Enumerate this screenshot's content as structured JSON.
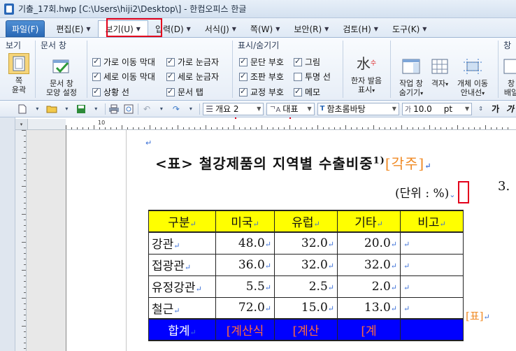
{
  "window": {
    "title": "기출_17회.hwp [C:\\Users\\hiji2\\Desktop\\] - 한컴오피스 한글"
  },
  "menu": {
    "tabs": [
      {
        "label": "파일(F)"
      },
      {
        "label": "편집(E)"
      },
      {
        "label": "보기(U)"
      },
      {
        "label": "입력(D)"
      },
      {
        "label": "서식(J)"
      },
      {
        "label": "쪽(W)"
      },
      {
        "label": "보안(R)"
      },
      {
        "label": "검토(H)"
      },
      {
        "label": "도구(K)"
      }
    ]
  },
  "ribbon": {
    "groups": {
      "view": "보기",
      "doc_window": "문서 창",
      "show_hide": "표시/숨기기",
      "window": "창"
    },
    "page_width": {
      "line1": "쪽",
      "line2": "윤곽"
    },
    "doc_window_style": {
      "line1": "문서 창",
      "line2": "모양 설정"
    },
    "checks": [
      {
        "label": "가로 이동 막대",
        "checked": true
      },
      {
        "label": "세로 이동 막대",
        "checked": true
      },
      {
        "label": "상황 선",
        "checked": true
      },
      {
        "label": "가로 눈금자",
        "checked": true
      },
      {
        "label": "세로 눈금자",
        "checked": true
      },
      {
        "label": "문서 탭",
        "checked": true
      },
      {
        "label": "문단 부호",
        "checked": true
      },
      {
        "label": "조판 부호",
        "checked": true
      },
      {
        "label": "교정 부호",
        "checked": true
      },
      {
        "label": "그림",
        "checked": true
      },
      {
        "label": "투명 선",
        "checked": false
      },
      {
        "label": "메모",
        "checked": true
      }
    ],
    "hanja": {
      "line1": "한자 발음",
      "line2": "표시"
    },
    "work_window": {
      "line1": "작업 창",
      "line2": "숨기기"
    },
    "grid": {
      "line1": "격자"
    },
    "object_move": {
      "line1": "개체 이동",
      "line2": "안내선"
    },
    "window_partial": {
      "line1": "창",
      "line2": "배일"
    }
  },
  "toolbar": {
    "style": "개요 2",
    "lang": "대표",
    "font": "함초롬바탕",
    "size": "10.0",
    "unit": "pt",
    "bold_label": "가",
    "italic_label": "가"
  },
  "ruler": {
    "mark": "10"
  },
  "document": {
    "title": "<표> 철강제품의 지역별 수출비중",
    "title_sup": "1)",
    "title_tag": "[각주]",
    "unit_label": "(단위 : %)",
    "side_number": "3.",
    "side_tag": "[표]",
    "table": {
      "headers": [
        "구분",
        "미국",
        "유럽",
        "기타",
        "비고"
      ],
      "rows": [
        [
          "강관",
          "48.0",
          "32.0",
          "20.0",
          ""
        ],
        [
          "접광관",
          "36.0",
          "32.0",
          "32.0",
          ""
        ],
        [
          "유정강관",
          "5.5",
          "2.5",
          "2.0",
          ""
        ],
        [
          "철근",
          "72.0",
          "15.0",
          "13.0",
          ""
        ]
      ],
      "total": [
        "합계",
        "[계산식",
        "[계산",
        "[계",
        ""
      ]
    }
  },
  "colors": {
    "header_bg": "#ffff00",
    "total_bg": "#0000ff",
    "highlight": "#e3001b",
    "tag": "#f08a24"
  }
}
